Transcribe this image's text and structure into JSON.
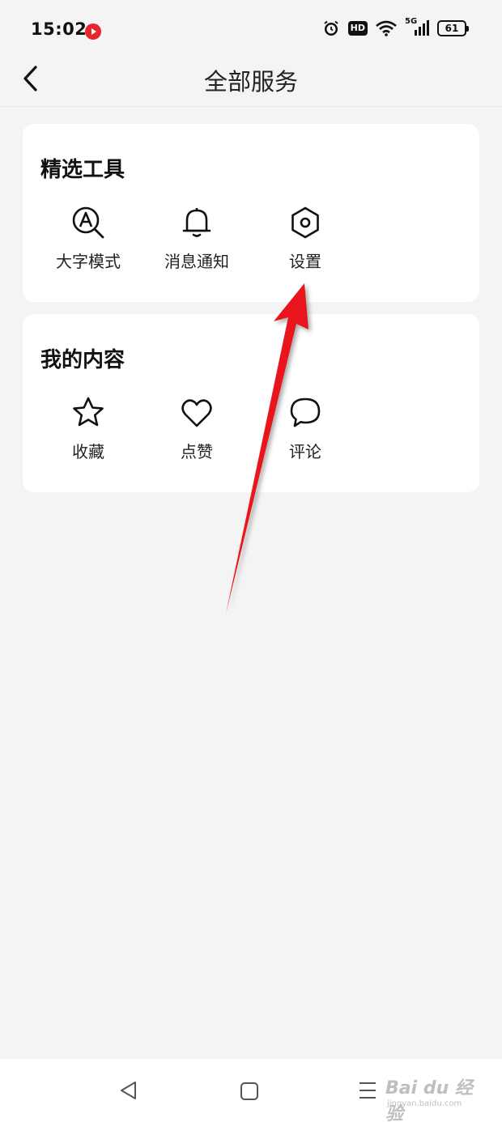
{
  "status_bar": {
    "time": "15:02",
    "hd_label": "HD",
    "network_label": "5G",
    "battery_level": "61",
    "icons": [
      "app-notification-icon",
      "alarm-icon",
      "wifi-icon",
      "signal-icon",
      "battery-icon"
    ]
  },
  "header": {
    "title": "全部服务",
    "back_icon": "chevron-left-icon"
  },
  "sections": [
    {
      "title": "精选工具",
      "items": [
        {
          "label": "大字模式",
          "icon": "large-font-search-icon"
        },
        {
          "label": "消息通知",
          "icon": "bell-icon"
        },
        {
          "label": "设置",
          "icon": "hexagon-settings-icon"
        }
      ]
    },
    {
      "title": "我的内容",
      "items": [
        {
          "label": "收藏",
          "icon": "star-icon"
        },
        {
          "label": "点赞",
          "icon": "heart-icon"
        },
        {
          "label": "评论",
          "icon": "speech-bubble-icon"
        }
      ]
    }
  ],
  "annotation": {
    "icon": "red-arrow-pointer",
    "color": "#e8141a"
  },
  "nav_bar": {
    "icons": [
      "nav-back-triangle-icon",
      "nav-home-square-icon",
      "nav-menu-lines-icon"
    ]
  },
  "watermark": {
    "logo": "Bai du 经验",
    "url": "jingyan.baidu.com"
  },
  "colors": {
    "background": "#f4f4f4",
    "card": "#ffffff",
    "text": "#111111",
    "arrow": "#e8141a"
  }
}
